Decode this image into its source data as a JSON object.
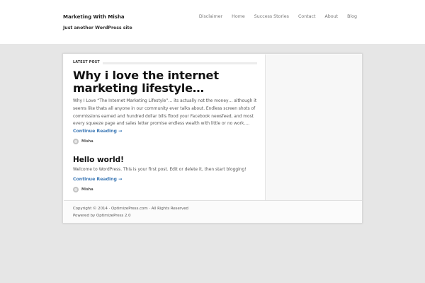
{
  "site": {
    "title": "Marketing With Misha",
    "tagline": "Just another WordPress site"
  },
  "nav": {
    "items": [
      "Disclaimer",
      "Home",
      "Success Stories",
      "Contact",
      "About",
      "Blog"
    ]
  },
  "main": {
    "section_label": "LATEST POST",
    "posts": [
      {
        "title": "Why i love the internet marketing lifestyle…",
        "excerpt": "Why I Love “The Internet Marketing Lifestyle”… its actually not the money… although it seems like thats all anyone in our community ever talks about. Endless screen shots of commissions earned and hundred dollar bills flood your Facebook newsfeed, and most every squeeze page and sales letter promise endless wealth with little or no work.…",
        "read_more": "Continue Reading →",
        "author": "Misha"
      },
      {
        "title": "Hello world!",
        "excerpt": "Welcome to WordPress. This is your first post. Edit or delete it, then start blogging!",
        "read_more": "Continue Reading →",
        "author": "Misha"
      }
    ]
  },
  "footer": {
    "copyright": "Copyright © 2014 · OptimizePress.com · All Rights Reserved",
    "powered_by": "Powered by OptimizePress 2.0"
  }
}
